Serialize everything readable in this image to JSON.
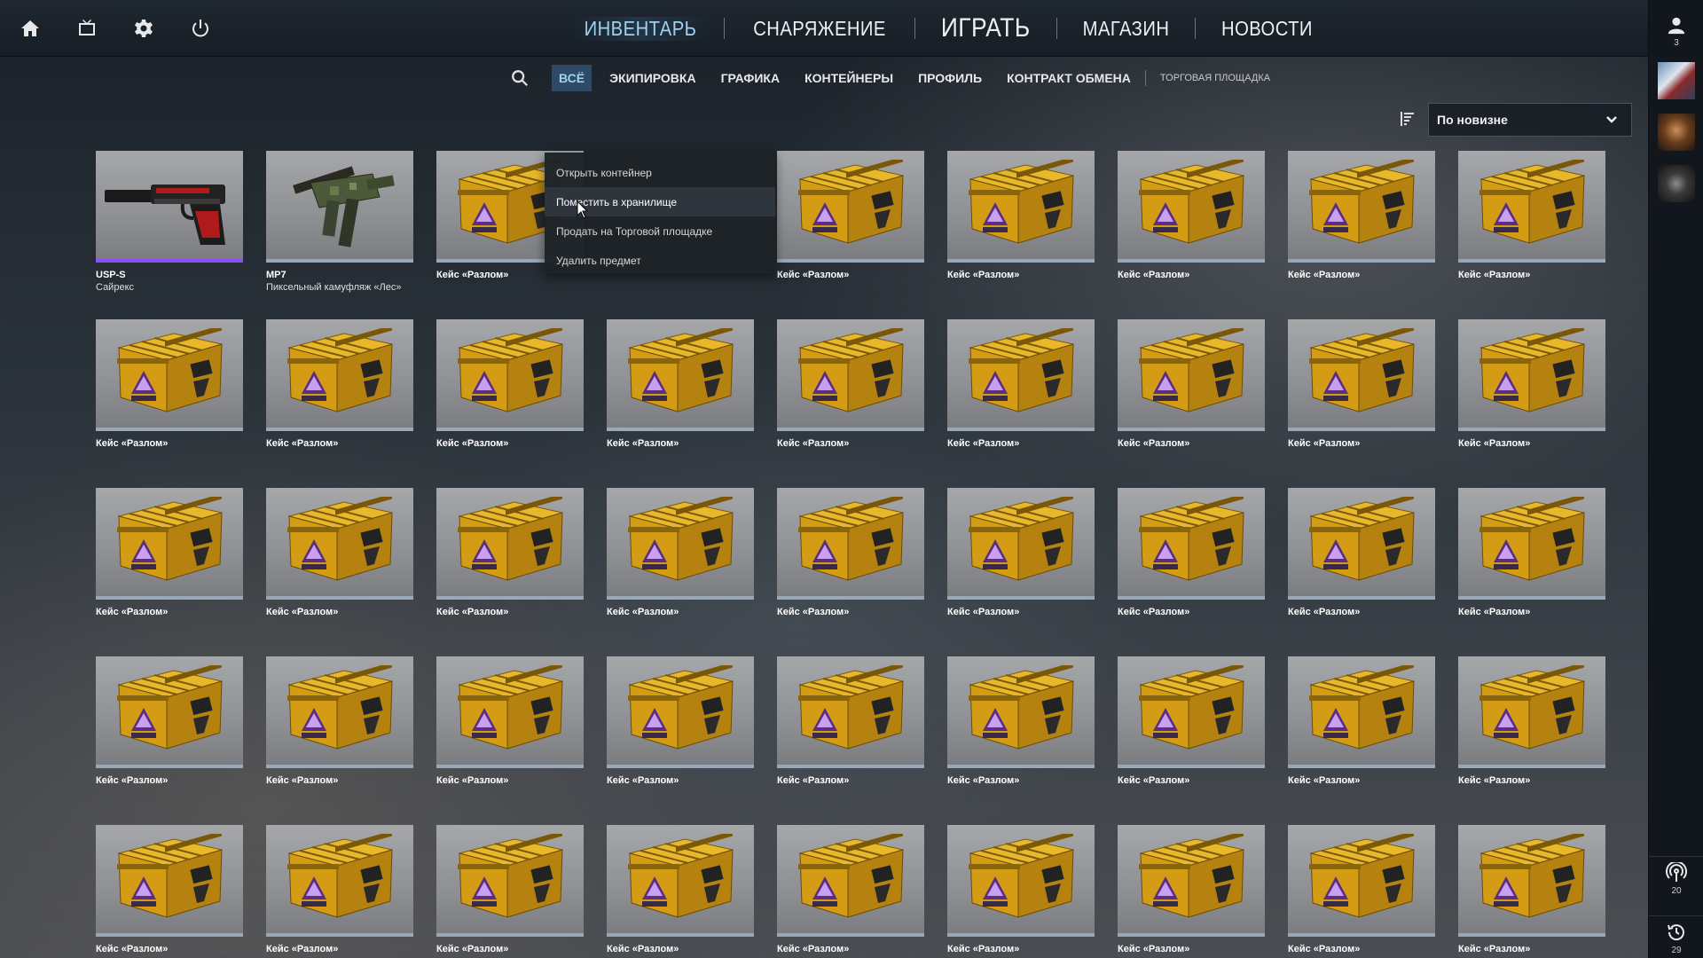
{
  "topbar": {
    "nav": [
      {
        "label": "ИНВЕНТАРЬ",
        "active": true
      },
      {
        "label": "СНАРЯЖЕНИЕ"
      },
      {
        "label": "ИГРАТЬ",
        "big": true
      },
      {
        "label": "МАГАЗИН"
      },
      {
        "label": "НОВОСТИ"
      }
    ]
  },
  "subnav": {
    "tabs": [
      "ВСЁ",
      "ЭКИПИРОВКА",
      "ГРАФИКА",
      "КОНТЕЙНЕРЫ",
      "ПРОФИЛЬ",
      "КОНТРАКТ ОБМЕНА"
    ],
    "market": "ТОРГОВАЯ ПЛОЩАДКА",
    "active_tab": "ВСЁ"
  },
  "sort": {
    "label": "По новизне"
  },
  "rightbar": {
    "friends_count": "3",
    "antenna_count": "20",
    "history_count": "29"
  },
  "context_menu": {
    "items": [
      "Открыть контейнер",
      "Поместить в хранилище",
      "Продать на Торговой площадке",
      "Удалить предмет"
    ],
    "hover_index": 1
  },
  "items": [
    {
      "name": "USP-S",
      "sub": "Сайрекс",
      "type": "pistol",
      "rarity": "rare"
    },
    {
      "name": "MP7",
      "sub": "Пиксельный камуфляж «Лес»",
      "type": "smg"
    },
    {
      "name": "Кейс «Разлом»",
      "type": "case"
    },
    {
      "name": "",
      "type": "hidden"
    },
    {
      "name": "Кейс «Разлом»",
      "type": "case"
    },
    {
      "name": "Кейс «Разлом»",
      "type": "case"
    },
    {
      "name": "Кейс «Разлом»",
      "type": "case"
    },
    {
      "name": "Кейс «Разлом»",
      "type": "case"
    },
    {
      "name": "Кейс «Разлом»",
      "type": "case"
    },
    {
      "name": "Кейс «Разлом»",
      "type": "case"
    },
    {
      "name": "Кейс «Разлом»",
      "type": "case"
    },
    {
      "name": "Кейс «Разлом»",
      "type": "case"
    },
    {
      "name": "Кейс «Разлом»",
      "type": "case"
    },
    {
      "name": "Кейс «Разлом»",
      "type": "case"
    },
    {
      "name": "Кейс «Разлом»",
      "type": "case"
    },
    {
      "name": "Кейс «Разлом»",
      "type": "case"
    },
    {
      "name": "Кейс «Разлом»",
      "type": "case"
    },
    {
      "name": "Кейс «Разлом»",
      "type": "case"
    },
    {
      "name": "Кейс «Разлом»",
      "type": "case"
    },
    {
      "name": "Кейс «Разлом»",
      "type": "case"
    },
    {
      "name": "Кейс «Разлом»",
      "type": "case"
    },
    {
      "name": "Кейс «Разлом»",
      "type": "case"
    },
    {
      "name": "Кейс «Разлом»",
      "type": "case"
    },
    {
      "name": "Кейс «Разлом»",
      "type": "case"
    },
    {
      "name": "Кейс «Разлом»",
      "type": "case"
    },
    {
      "name": "Кейс «Разлом»",
      "type": "case"
    },
    {
      "name": "Кейс «Разлом»",
      "type": "case"
    },
    {
      "name": "Кейс «Разлом»",
      "type": "case"
    },
    {
      "name": "Кейс «Разлом»",
      "type": "case"
    },
    {
      "name": "Кейс «Разлом»",
      "type": "case"
    },
    {
      "name": "Кейс «Разлом»",
      "type": "case"
    },
    {
      "name": "Кейс «Разлом»",
      "type": "case"
    },
    {
      "name": "Кейс «Разлом»",
      "type": "case"
    },
    {
      "name": "Кейс «Разлом»",
      "type": "case"
    },
    {
      "name": "Кейс «Разлом»",
      "type": "case"
    },
    {
      "name": "Кейс «Разлом»",
      "type": "case"
    },
    {
      "name": "Кейс «Разлом»",
      "type": "case"
    },
    {
      "name": "Кейс «Разлом»",
      "type": "case"
    },
    {
      "name": "Кейс «Разлом»",
      "type": "case"
    },
    {
      "name": "Кейс «Разлом»",
      "type": "case"
    },
    {
      "name": "Кейс «Разлом»",
      "type": "case"
    },
    {
      "name": "Кейс «Разлом»",
      "type": "case"
    },
    {
      "name": "Кейс «Разлом»",
      "type": "case"
    },
    {
      "name": "Кейс «Разлом»",
      "type": "case"
    },
    {
      "name": "Кейс «Разлом»",
      "type": "case"
    }
  ]
}
